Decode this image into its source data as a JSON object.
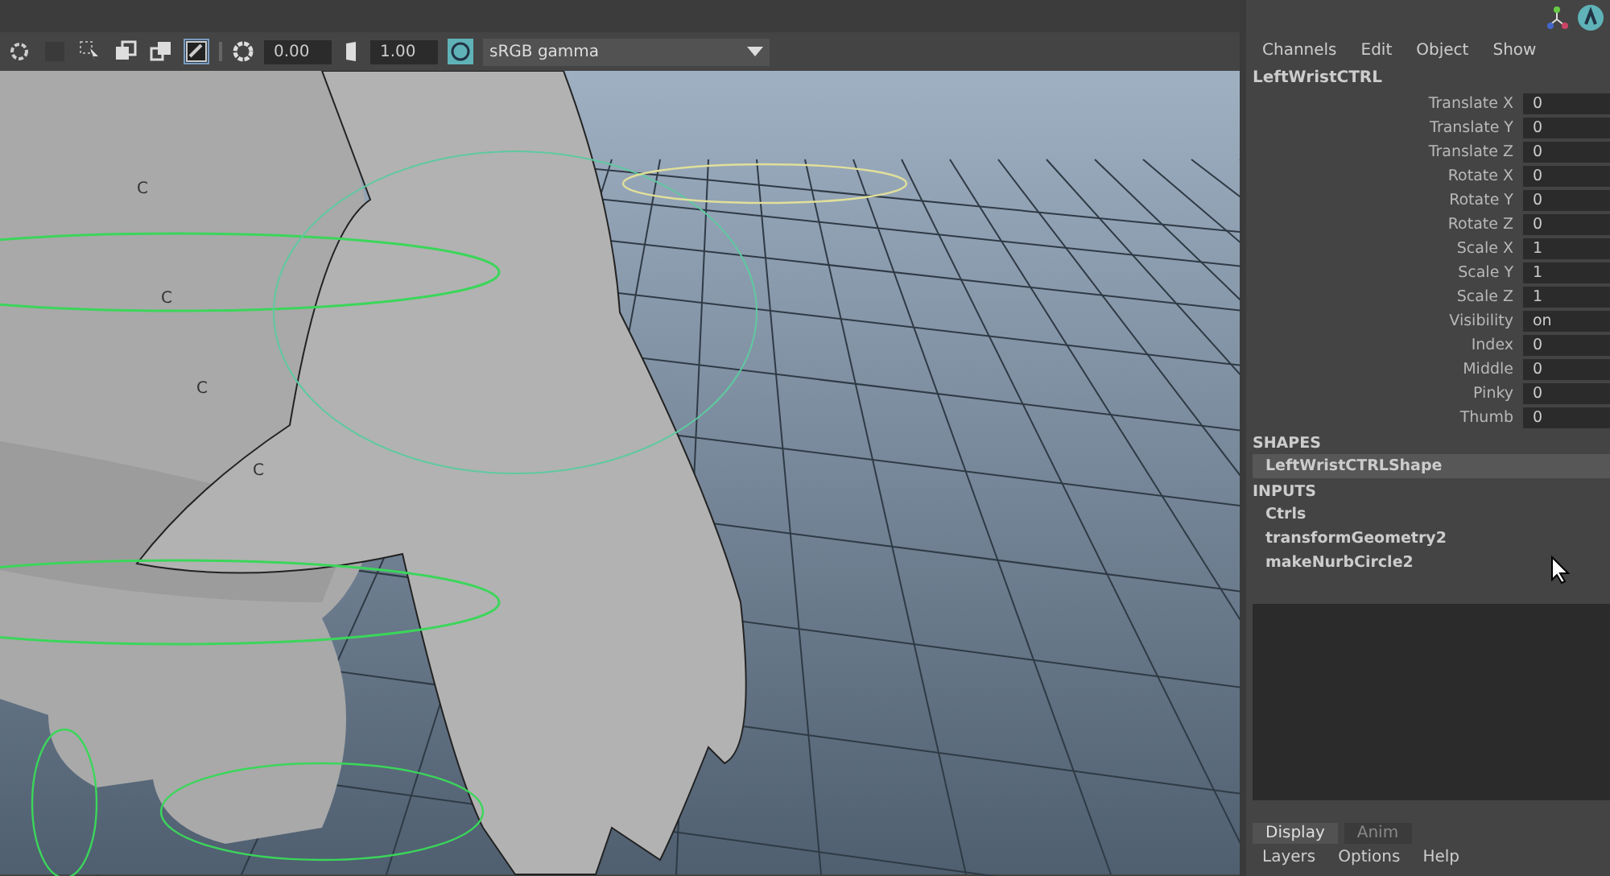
{
  "toolbar": {
    "tools": [
      {
        "kind": "ring",
        "selected": false
      },
      {
        "kind": "square",
        "selected": false
      },
      {
        "kind": "select",
        "selected": false
      },
      {
        "kind": "overlap",
        "selected": false
      },
      {
        "kind": "overlap2",
        "selected": false
      },
      {
        "kind": "image",
        "selected": true
      }
    ],
    "exposure": "0.00",
    "gamma": "1.00",
    "color_space": "sRGB gamma"
  },
  "viewport": {
    "locator_labels": [
      "C",
      "C",
      "C",
      "C"
    ]
  },
  "channel_box": {
    "menu": [
      "Channels",
      "Edit",
      "Object",
      "Show"
    ],
    "object_name": "LeftWristCTRL",
    "channels": [
      {
        "name": "Translate X",
        "value": "0"
      },
      {
        "name": "Translate Y",
        "value": "0"
      },
      {
        "name": "Translate Z",
        "value": "0"
      },
      {
        "name": "Rotate X",
        "value": "0"
      },
      {
        "name": "Rotate Y",
        "value": "0"
      },
      {
        "name": "Rotate Z",
        "value": "0"
      },
      {
        "name": "Scale X",
        "value": "1"
      },
      {
        "name": "Scale Y",
        "value": "1"
      },
      {
        "name": "Scale Z",
        "value": "1"
      },
      {
        "name": "Visibility",
        "value": "on"
      },
      {
        "name": "Index",
        "value": "0"
      },
      {
        "name": "Middle",
        "value": "0"
      },
      {
        "name": "Pinky",
        "value": "0"
      },
      {
        "name": "Thumb",
        "value": "0"
      }
    ],
    "shapes_heading": "SHAPES",
    "shapes": [
      {
        "name": "LeftWristCTRLShape",
        "selected": true
      }
    ],
    "inputs_heading": "INPUTS",
    "inputs": [
      {
        "name": "Ctrls",
        "selected": false
      },
      {
        "name": "transformGeometry2",
        "selected": false
      },
      {
        "name": "makeNurbCircle2",
        "selected": false
      }
    ]
  },
  "layer_editor": {
    "tabs": [
      {
        "label": "Display",
        "selected": true
      },
      {
        "label": "Anim",
        "selected": false
      }
    ],
    "menu": [
      "Layers",
      "Options",
      "Help"
    ]
  }
}
